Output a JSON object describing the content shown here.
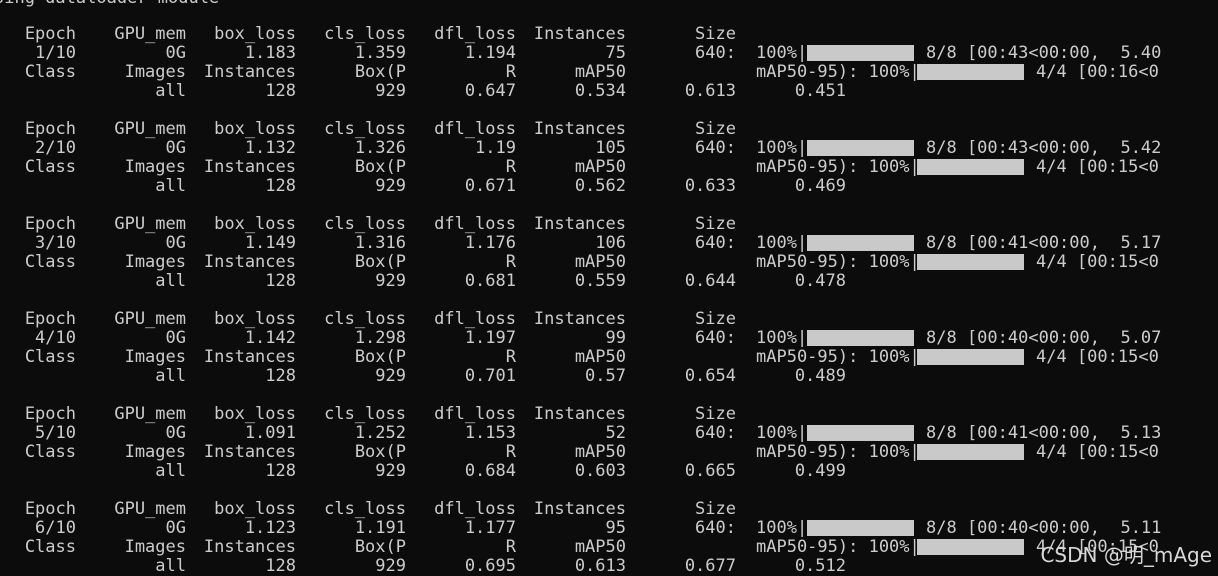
{
  "top_partial": "sing dataloader module",
  "headers": {
    "train": [
      "Epoch",
      "GPU_mem",
      "box_loss",
      "cls_loss",
      "dfl_loss",
      "Instances",
      "Size"
    ],
    "val": [
      "Class",
      "Images",
      "Instances",
      "Box(P",
      "R",
      "mAP50",
      "mAP50-95): 100%|"
    ]
  },
  "epochs": [
    {
      "train": [
        "1/10",
        "0G",
        "1.183",
        "1.359",
        "1.194",
        "75",
        "640:"
      ],
      "train_pct": "100%|",
      "train_tail": "8/8 [00:43<00:00,  5.40",
      "train_progress": 1.0,
      "val": [
        "all",
        "128",
        "929",
        "0.647",
        "0.534",
        "0.613",
        "0.451"
      ],
      "val_tail": "4/4 [00:16<0",
      "val_progress": 1.0
    },
    {
      "train": [
        "2/10",
        "0G",
        "1.132",
        "1.326",
        "1.19",
        "105",
        "640:"
      ],
      "train_pct": "100%|",
      "train_tail": "8/8 [00:43<00:00,  5.42",
      "train_progress": 1.0,
      "val": [
        "all",
        "128",
        "929",
        "0.671",
        "0.562",
        "0.633",
        "0.469"
      ],
      "val_tail": "4/4 [00:15<0",
      "val_progress": 1.0
    },
    {
      "train": [
        "3/10",
        "0G",
        "1.149",
        "1.316",
        "1.176",
        "106",
        "640:"
      ],
      "train_pct": "100%|",
      "train_tail": "8/8 [00:41<00:00,  5.17",
      "train_progress": 1.0,
      "val": [
        "all",
        "128",
        "929",
        "0.681",
        "0.559",
        "0.644",
        "0.478"
      ],
      "val_tail": "4/4 [00:15<0",
      "val_progress": 1.0
    },
    {
      "train": [
        "4/10",
        "0G",
        "1.142",
        "1.298",
        "1.197",
        "99",
        "640:"
      ],
      "train_pct": "100%|",
      "train_tail": "8/8 [00:40<00:00,  5.07",
      "train_progress": 1.0,
      "val": [
        "all",
        "128",
        "929",
        "0.701",
        "0.57",
        "0.654",
        "0.489"
      ],
      "val_tail": "4/4 [00:15<0",
      "val_progress": 1.0
    },
    {
      "train": [
        "5/10",
        "0G",
        "1.091",
        "1.252",
        "1.153",
        "52",
        "640:"
      ],
      "train_pct": "100%|",
      "train_tail": "8/8 [00:41<00:00,  5.13",
      "train_progress": 1.0,
      "val": [
        "all",
        "128",
        "929",
        "0.684",
        "0.603",
        "0.665",
        "0.499"
      ],
      "val_tail": "4/4 [00:15<0",
      "val_progress": 1.0
    },
    {
      "train": [
        "6/10",
        "0G",
        "1.123",
        "1.191",
        "1.177",
        "95",
        "640:"
      ],
      "train_pct": "100%|",
      "train_tail": "8/8 [00:40<00:00,  5.11",
      "train_progress": 1.0,
      "val": [
        "all",
        "128",
        "929",
        "0.695",
        "0.613",
        "0.677",
        "0.512"
      ],
      "val_tail": "4/4 [00:15<0",
      "val_progress": 1.0
    }
  ],
  "watermark": "CSDN @明_mAge",
  "colors": {
    "background": "#0c0c0c",
    "text": "#cccccc",
    "progress_bar": "#c9c9c9"
  }
}
